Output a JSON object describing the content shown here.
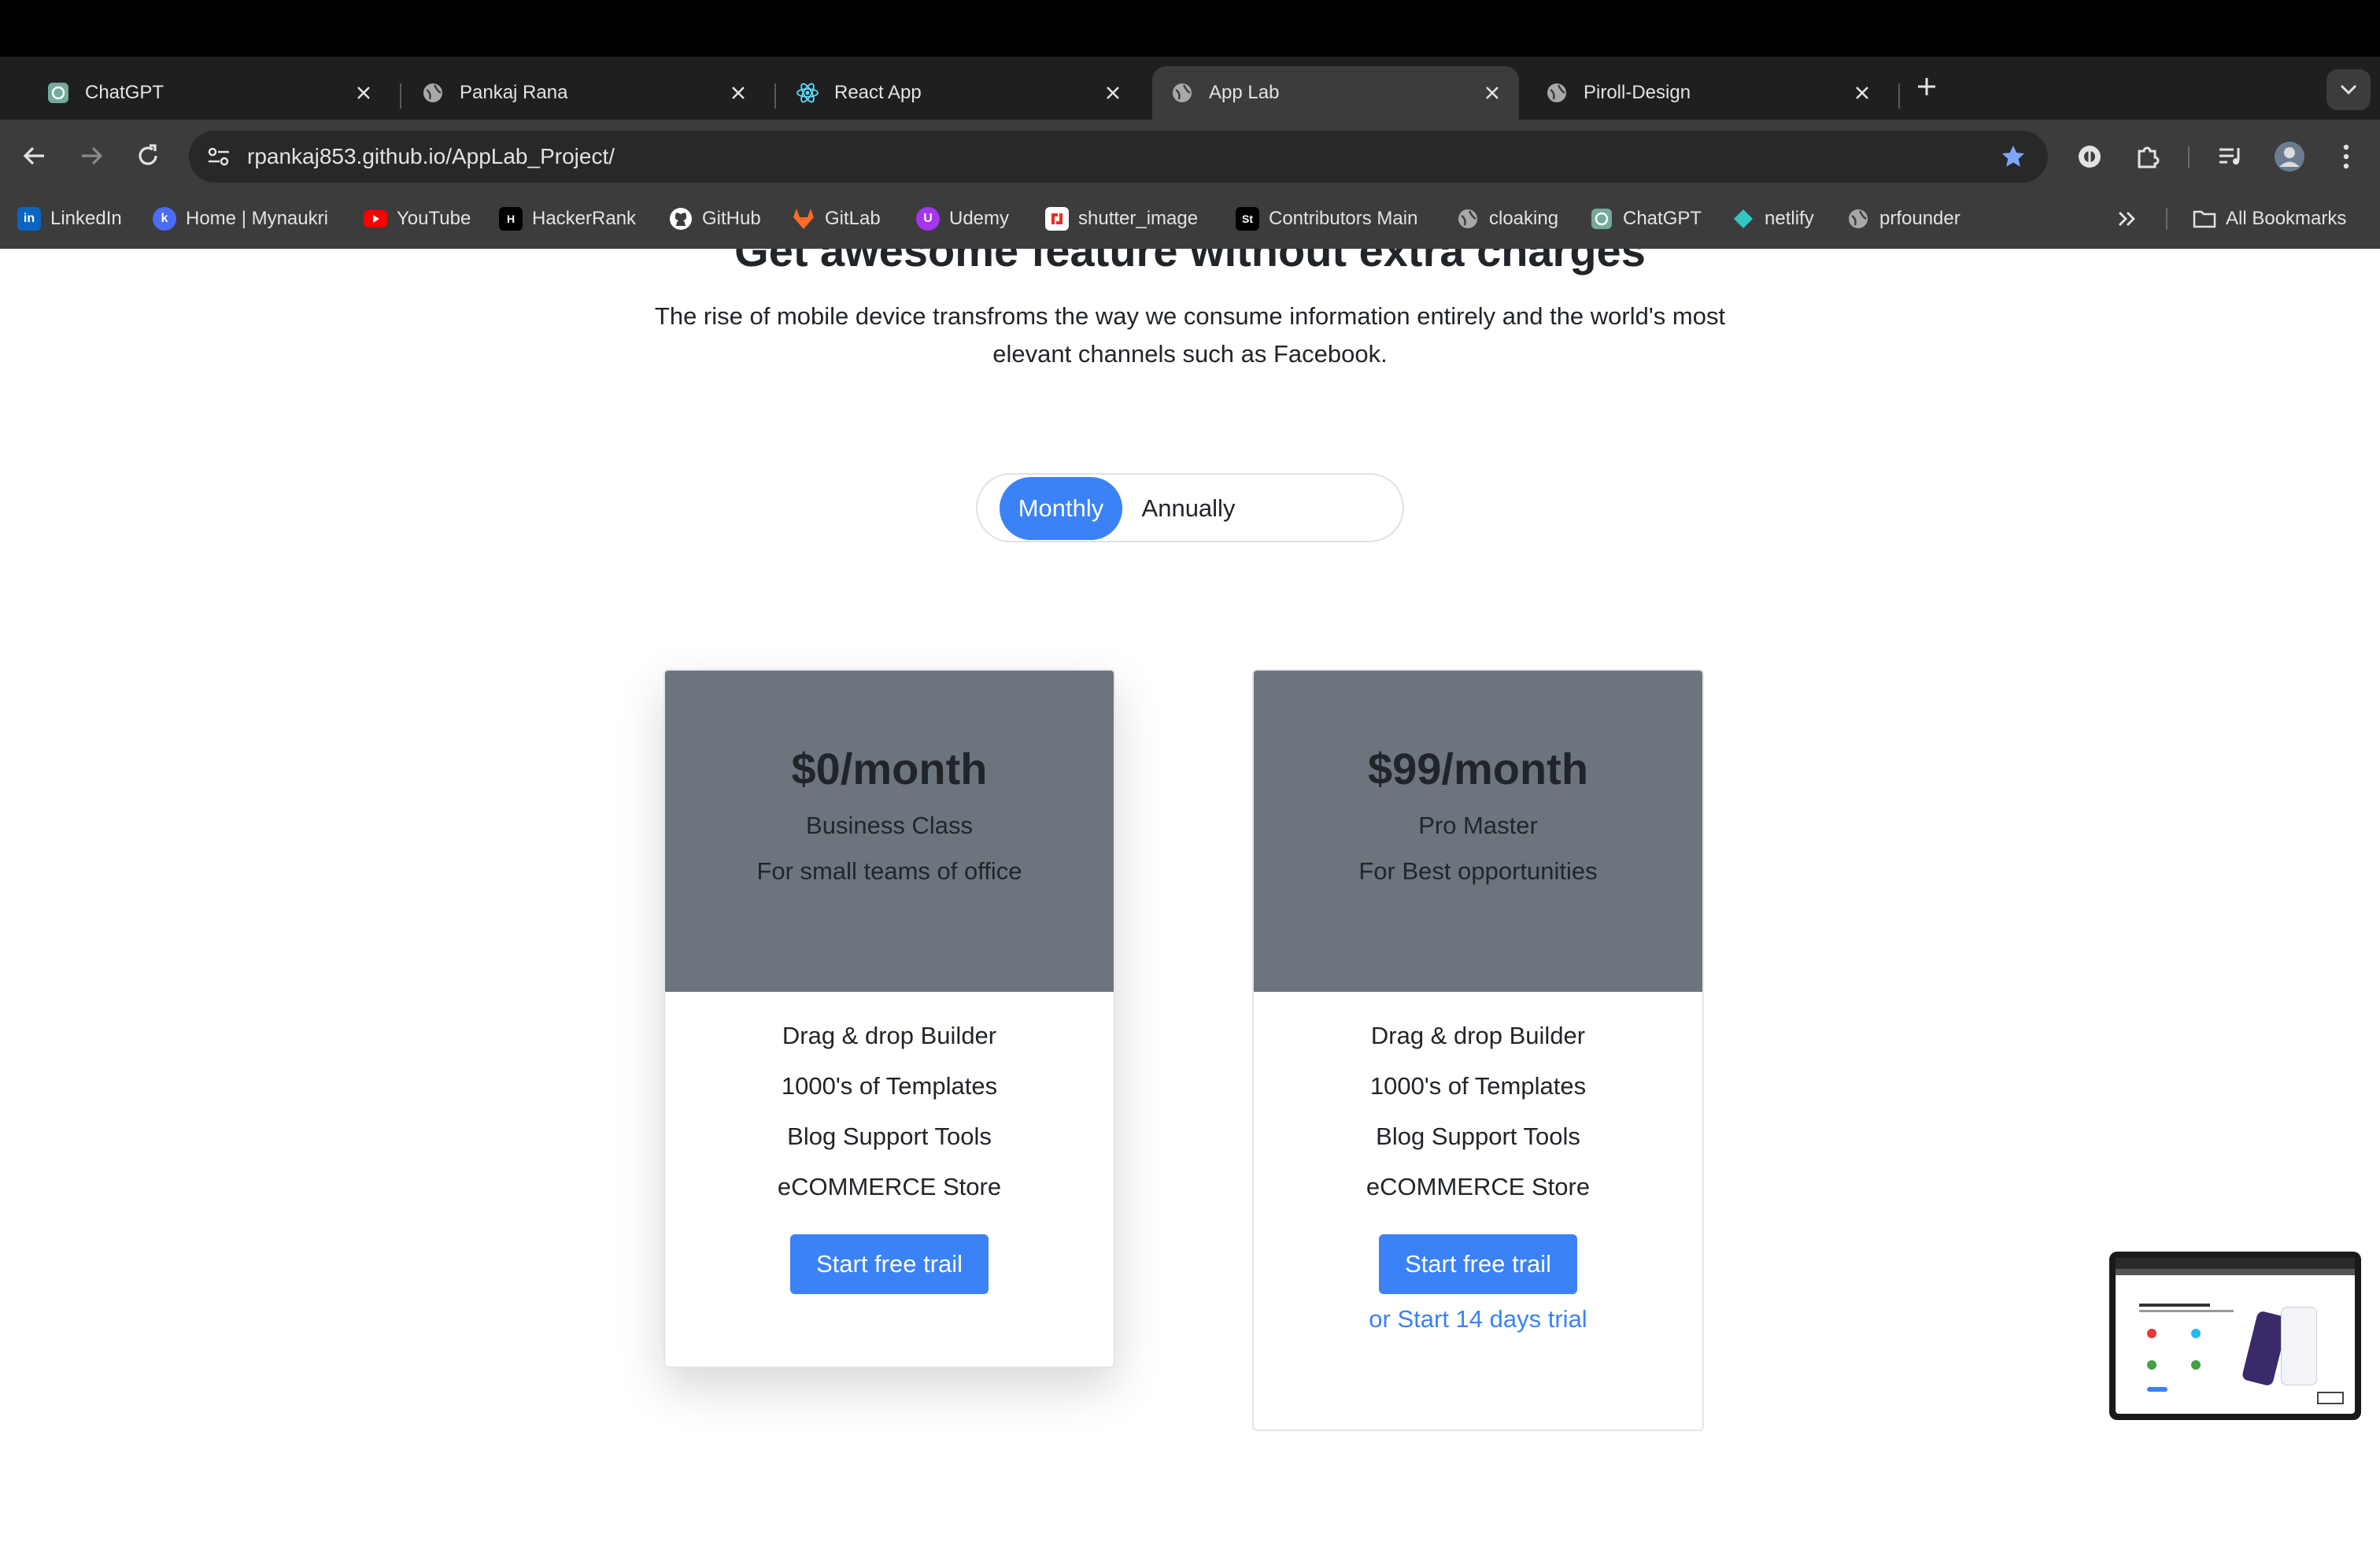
{
  "browser": {
    "tabs": [
      {
        "title": "ChatGPT",
        "icon": "chatgpt-icon",
        "active": false
      },
      {
        "title": "Pankaj Rana",
        "icon": "globe-icon",
        "active": false
      },
      {
        "title": "React App",
        "icon": "react-icon",
        "active": false
      },
      {
        "title": "App Lab",
        "icon": "globe-icon",
        "active": true
      },
      {
        "title": "Piroll-Design",
        "icon": "globe-icon",
        "active": false
      }
    ],
    "url": "rpankaj853.github.io/AppLab_Project/",
    "bookmarks": [
      {
        "label": "LinkedIn",
        "icon": "linkedin-icon",
        "color": "#0a66c2"
      },
      {
        "label": "Home | Mynaukri",
        "icon": "mynaukri-icon",
        "color": "#4a6cf7"
      },
      {
        "label": "YouTube",
        "icon": "youtube-icon",
        "color": "#ff0000"
      },
      {
        "label": "HackerRank",
        "icon": "hackerrank-icon",
        "color": "#1ba94c"
      },
      {
        "label": "GitHub",
        "icon": "github-icon",
        "color": "#ffffff"
      },
      {
        "label": "GitLab",
        "icon": "gitlab-icon",
        "color": "#fc6d26"
      },
      {
        "label": "Udemy",
        "icon": "udemy-icon",
        "color": "#a435f0"
      },
      {
        "label": "shutter_image",
        "icon": "shutterstock-icon",
        "color": "#ee2b24"
      },
      {
        "label": "Contributors Main",
        "icon": "st-icon",
        "color": "#000000"
      },
      {
        "label": "cloaking",
        "icon": "globe-icon",
        "color": "#e3e3e3"
      },
      {
        "label": "ChatGPT",
        "icon": "chatgpt-icon",
        "color": "#74aa9c"
      },
      {
        "label": "netlify",
        "icon": "netlify-icon",
        "color": "#32e6e2"
      },
      {
        "label": "prfounder",
        "icon": "globe-icon",
        "color": "#e3e3e3"
      }
    ],
    "all_bookmarks_label": "All Bookmarks"
  },
  "page": {
    "heading": "Get awesome feature without extra charges",
    "subtext": "The rise of mobile device transfroms the way we consume information entirely and the world's most elevant channels such as Facebook.",
    "toggle": {
      "monthly": "Monthly",
      "annually": "Annually",
      "selected": "Monthly"
    },
    "plans": [
      {
        "price": "$0/month",
        "name": "Business Class",
        "description": "For small teams of office",
        "features": [
          "Drag & drop Builder",
          "1000's of Templates",
          "Blog Support Tools",
          "eCOMMERCE Store"
        ],
        "cta": "Start free trail",
        "trial_link": ""
      },
      {
        "price": "$99/month",
        "name": "Pro Master",
        "description": "For Best opportunities",
        "features": [
          "Drag & drop Builder",
          "1000's of Templates",
          "Blog Support Tools",
          "eCOMMERCE Store"
        ],
        "cta": "Start free trail",
        "trial_link": "or Start 14 days trial"
      }
    ]
  },
  "colors": {
    "accent": "#3b82f6",
    "card_header": "#6c757d",
    "chrome_dark": "#1f1f1f",
    "chrome_mid": "#3c3c3c"
  }
}
